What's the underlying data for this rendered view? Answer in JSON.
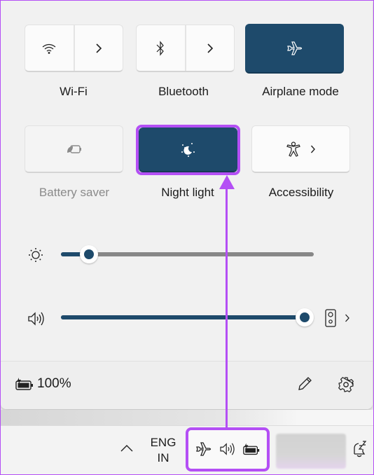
{
  "quick_settings": {
    "tiles": [
      {
        "label": "Wi-Fi",
        "icon": "wifi-icon",
        "state": "off",
        "has_expand": true
      },
      {
        "label": "Bluetooth",
        "icon": "bluetooth-icon",
        "state": "off",
        "has_expand": true
      },
      {
        "label": "Airplane mode",
        "icon": "airplane-icon",
        "state": "on",
        "has_expand": false
      },
      {
        "label": "Battery saver",
        "icon": "battery-saver-icon",
        "state": "disabled",
        "has_expand": false
      },
      {
        "label": "Night light",
        "icon": "night-light-icon",
        "state": "on",
        "has_expand": false,
        "highlighted": true
      },
      {
        "label": "Accessibility",
        "icon": "accessibility-icon",
        "state": "off",
        "has_expand": true
      }
    ],
    "brightness": {
      "icon": "brightness-icon",
      "value_percent": 8
    },
    "volume": {
      "icon": "volume-icon",
      "value_percent": 100,
      "output_device_icon": "speaker-icon"
    },
    "footer": {
      "battery_icon": "battery-charging-icon",
      "battery_text": "100%",
      "edit_icon": "pencil-icon",
      "settings_icon": "gear-icon"
    }
  },
  "taskbar": {
    "overflow_icon": "chevron-up-icon",
    "language_line1": "ENG",
    "language_line2": "IN",
    "system_icons": [
      "airplane-icon",
      "volume-icon",
      "battery-charging-icon"
    ],
    "notification_icon": "bell-snooze-icon"
  },
  "annotation": {
    "color": "#b44ff5"
  },
  "colors": {
    "accent": "#1e4a6b",
    "panel": "#f1f1f1"
  }
}
